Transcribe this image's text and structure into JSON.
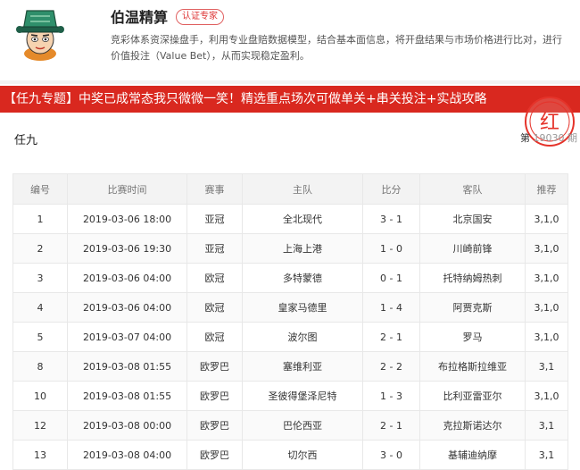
{
  "profile": {
    "name": "伯温精算",
    "badge": "认证专家",
    "bio": "竞彩体系资深操盘手，利用专业盘赔数据模型，结合基本面信息，将开盘结果与市场价格进行比对，进行价值投注（Value Bet），从而实现稳定盈利。",
    "avatar_icon": "cartoon-official-avatar-icon"
  },
  "banner": {
    "text": "【任九专题】中奖已成常态我只微微一笑！精选重点场次可做单关+串关投注+实战攻略",
    "color": "#d9281f"
  },
  "stamp": {
    "icon": "red-seal-stamp-icon",
    "text": "红"
  },
  "section": {
    "title": "任九",
    "issue_prefix": "第",
    "issue_number": "19030",
    "issue_suffix": "期"
  },
  "table": {
    "headers": [
      "编号",
      "比赛时间",
      "赛事",
      "主队",
      "比分",
      "客队",
      "推荐"
    ],
    "rows": [
      [
        "1",
        "2019-03-06 18:00",
        "亚冠",
        "全北现代",
        "3 - 1",
        "北京国安",
        "3,1,0"
      ],
      [
        "2",
        "2019-03-06 19:30",
        "亚冠",
        "上海上港",
        "1 - 0",
        "川崎前锋",
        "3,1,0"
      ],
      [
        "3",
        "2019-03-06 04:00",
        "欧冠",
        "多特蒙德",
        "0 - 1",
        "托特纳姆热刺",
        "3,1,0"
      ],
      [
        "4",
        "2019-03-06 04:00",
        "欧冠",
        "皇家马德里",
        "1 - 4",
        "阿贾克斯",
        "3,1,0"
      ],
      [
        "5",
        "2019-03-07 04:00",
        "欧冠",
        "波尔图",
        "2 - 1",
        "罗马",
        "3,1,0"
      ],
      [
        "8",
        "2019-03-08 01:55",
        "欧罗巴",
        "塞维利亚",
        "2 - 2",
        "布拉格斯拉维亚",
        "3,1"
      ],
      [
        "10",
        "2019-03-08 01:55",
        "欧罗巴",
        "圣彼得堡泽尼特",
        "1 - 3",
        "比利亚雷亚尔",
        "3,1,0"
      ],
      [
        "12",
        "2019-03-08 00:00",
        "欧罗巴",
        "巴伦西亚",
        "2 - 1",
        "克拉斯诺达尔",
        "3,1"
      ],
      [
        "13",
        "2019-03-08 04:00",
        "欧罗巴",
        "切尔西",
        "3 - 0",
        "基辅迪纳摩",
        "3,1"
      ]
    ]
  }
}
